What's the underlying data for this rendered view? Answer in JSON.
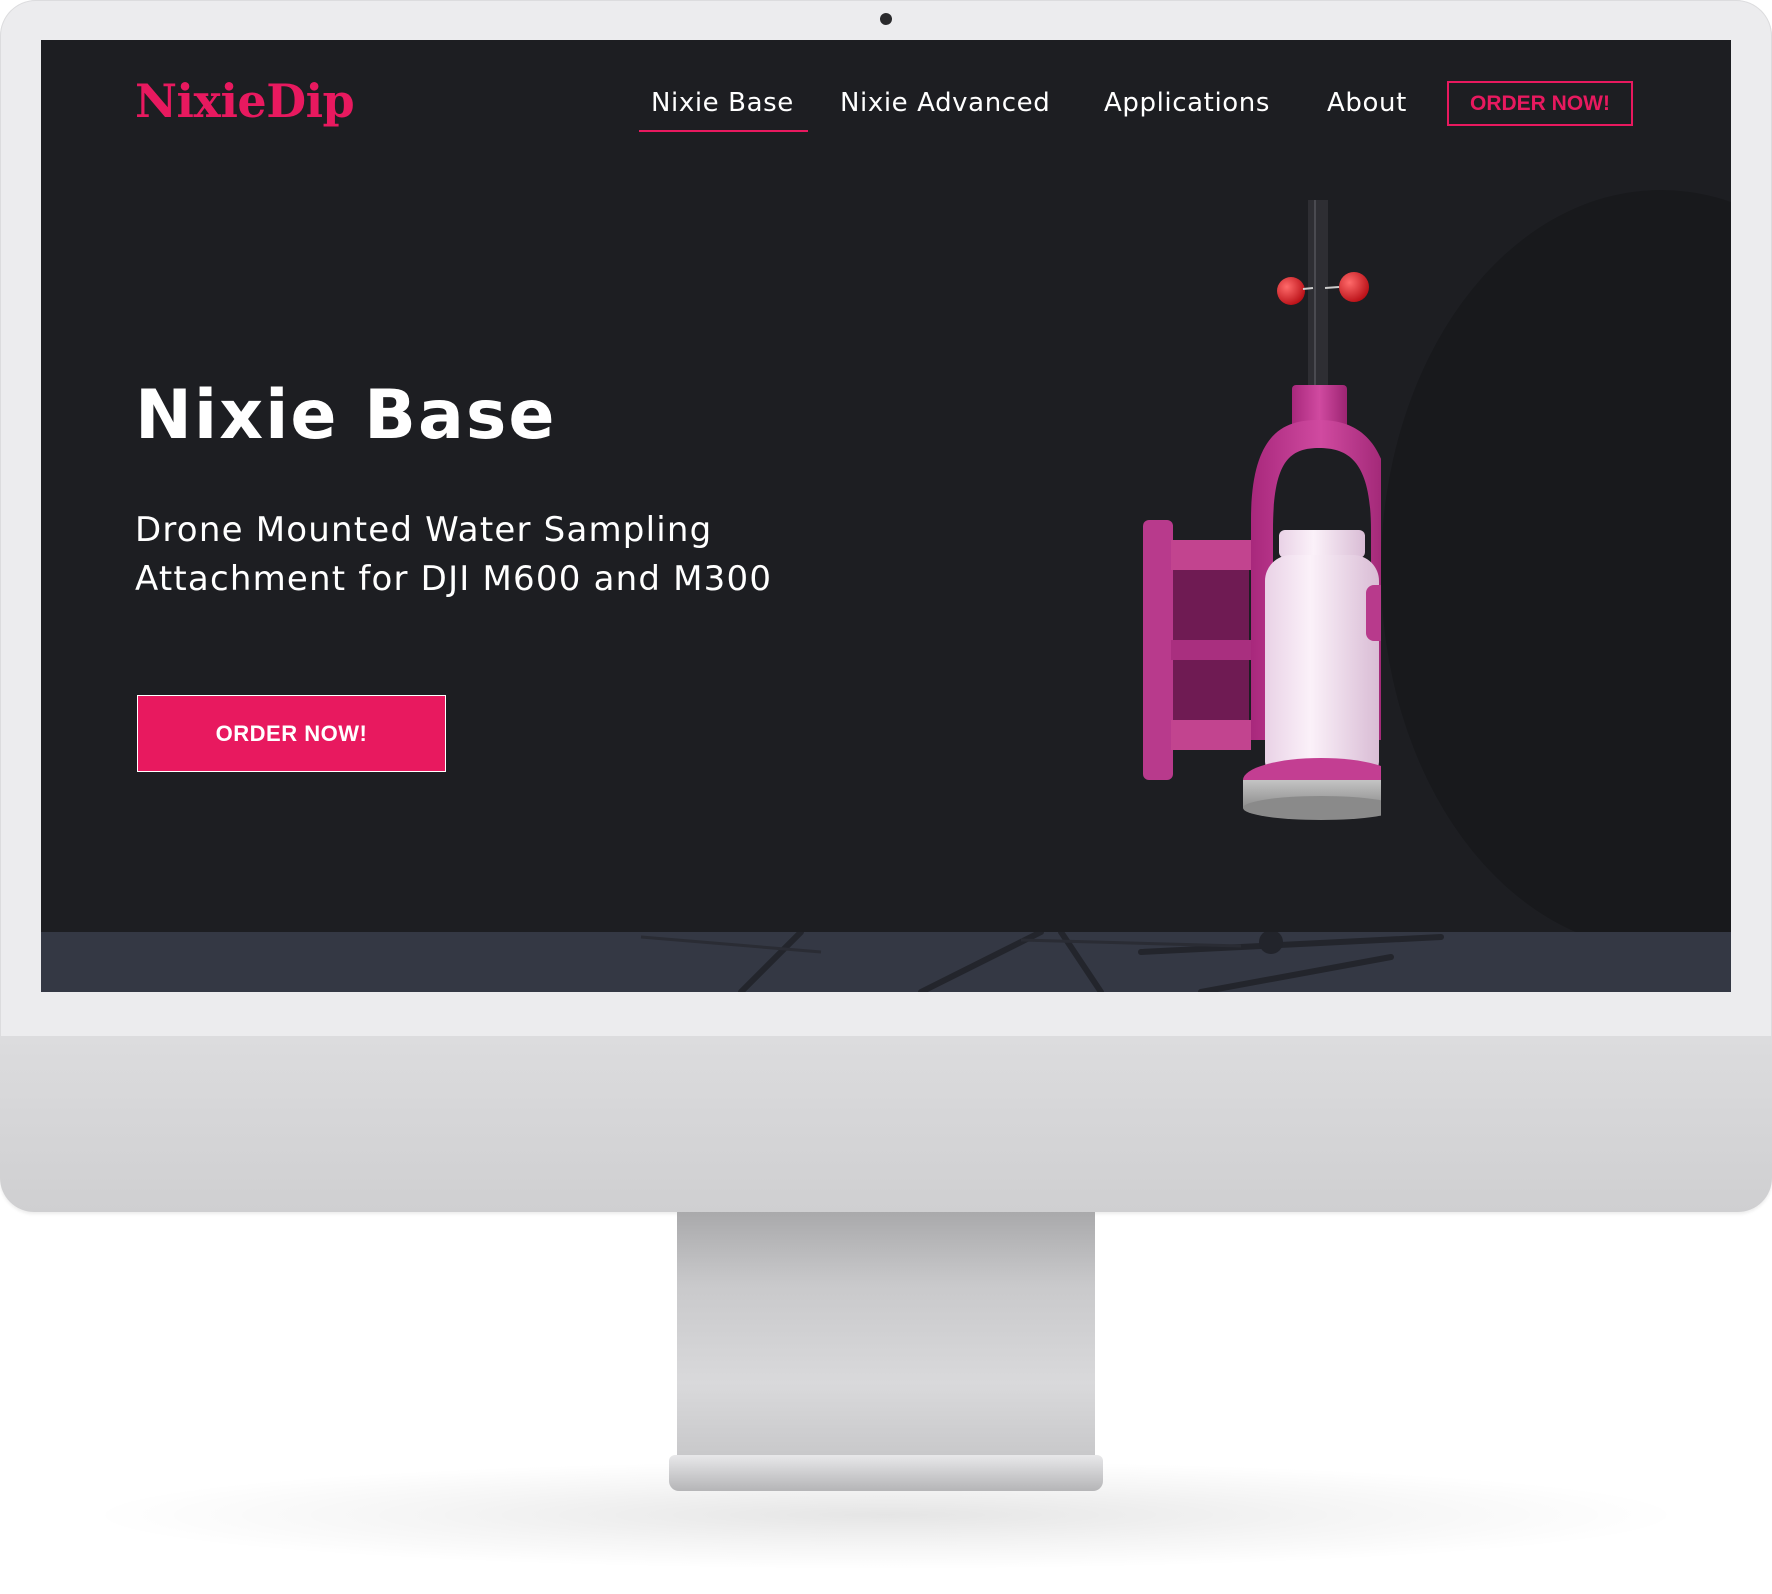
{
  "brand": {
    "logo_text": "NixieDip",
    "accent_color": "#e8195f",
    "background_color": "#1d1e22"
  },
  "nav": {
    "items": [
      {
        "label": "Nixie Base",
        "active": true
      },
      {
        "label": "Nixie Advanced",
        "active": false
      },
      {
        "label": "Applications",
        "active": false
      },
      {
        "label": "About",
        "active": false
      }
    ],
    "order_label": "ORDER NOW!"
  },
  "hero": {
    "title": "Nixie Base",
    "subtitle_line1": "Drone Mounted Water Sampling",
    "subtitle_line2": "Attachment for DJI M600 and M300",
    "cta_label": "ORDER NOW!"
  },
  "images": {
    "product": "nixie-base-sampler-with-bottle",
    "next_section": "drone-silhouette-background"
  }
}
